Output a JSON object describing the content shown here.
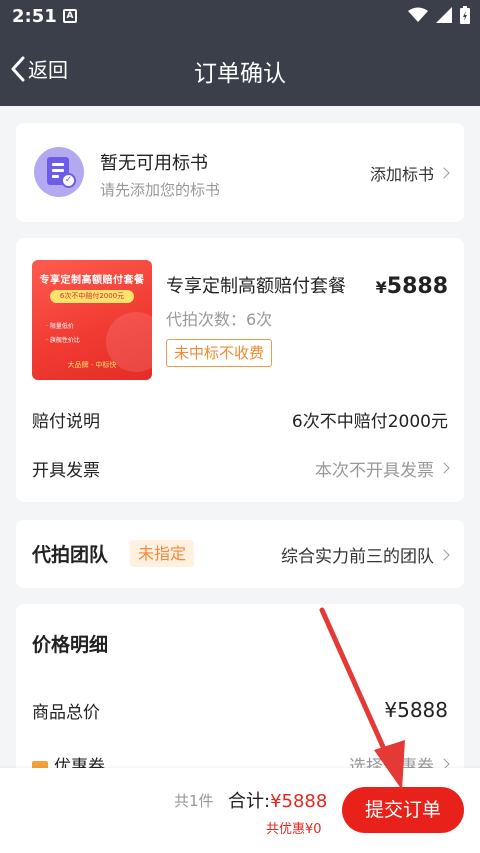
{
  "status_bar": {
    "time": "2:51",
    "notification_glyph": "A"
  },
  "nav": {
    "back_label": "返回",
    "title": "订单确认"
  },
  "bid_card": {
    "title": "暂无可用标书",
    "subtitle": "请先添加您的标书",
    "action_label": "添加标书"
  },
  "package": {
    "image_title": "专享定制高额赔付套餐",
    "image_badge": "6次不中赔付2000元",
    "image_bullets": [
      "· 限量低价",
      "· 旗舰性价比"
    ],
    "image_footer": "大品牌 · 中标快",
    "name": "专享定制高额赔付套餐",
    "price_symbol": "¥",
    "price": "5888",
    "count_text": "代拍次数：6次",
    "tag": "未中标不收费",
    "compensation_label": "赔付说明",
    "compensation_value": "6次不中赔付2000元",
    "invoice_label": "开具发票",
    "invoice_value": "本次不开具发票"
  },
  "team": {
    "label": "代拍团队",
    "tag": "未指定",
    "value": "综合实力前三的团队"
  },
  "price_detail": {
    "title": "价格明细",
    "total_label": "商品总价",
    "total_value": "¥5888",
    "coupon_label": "优惠券",
    "coupon_value": "选择优惠券"
  },
  "bottom_bar": {
    "count": "共1件",
    "total_label": "合计:",
    "total_amount": "¥5888",
    "discount": "共优惠¥0",
    "submit_label": "提交订单"
  },
  "colors": {
    "header_bg": "#3b3f4a",
    "accent_red": "#e8221b",
    "tag_orange": "#f5893a",
    "annotation_arrow": "#e53935"
  }
}
